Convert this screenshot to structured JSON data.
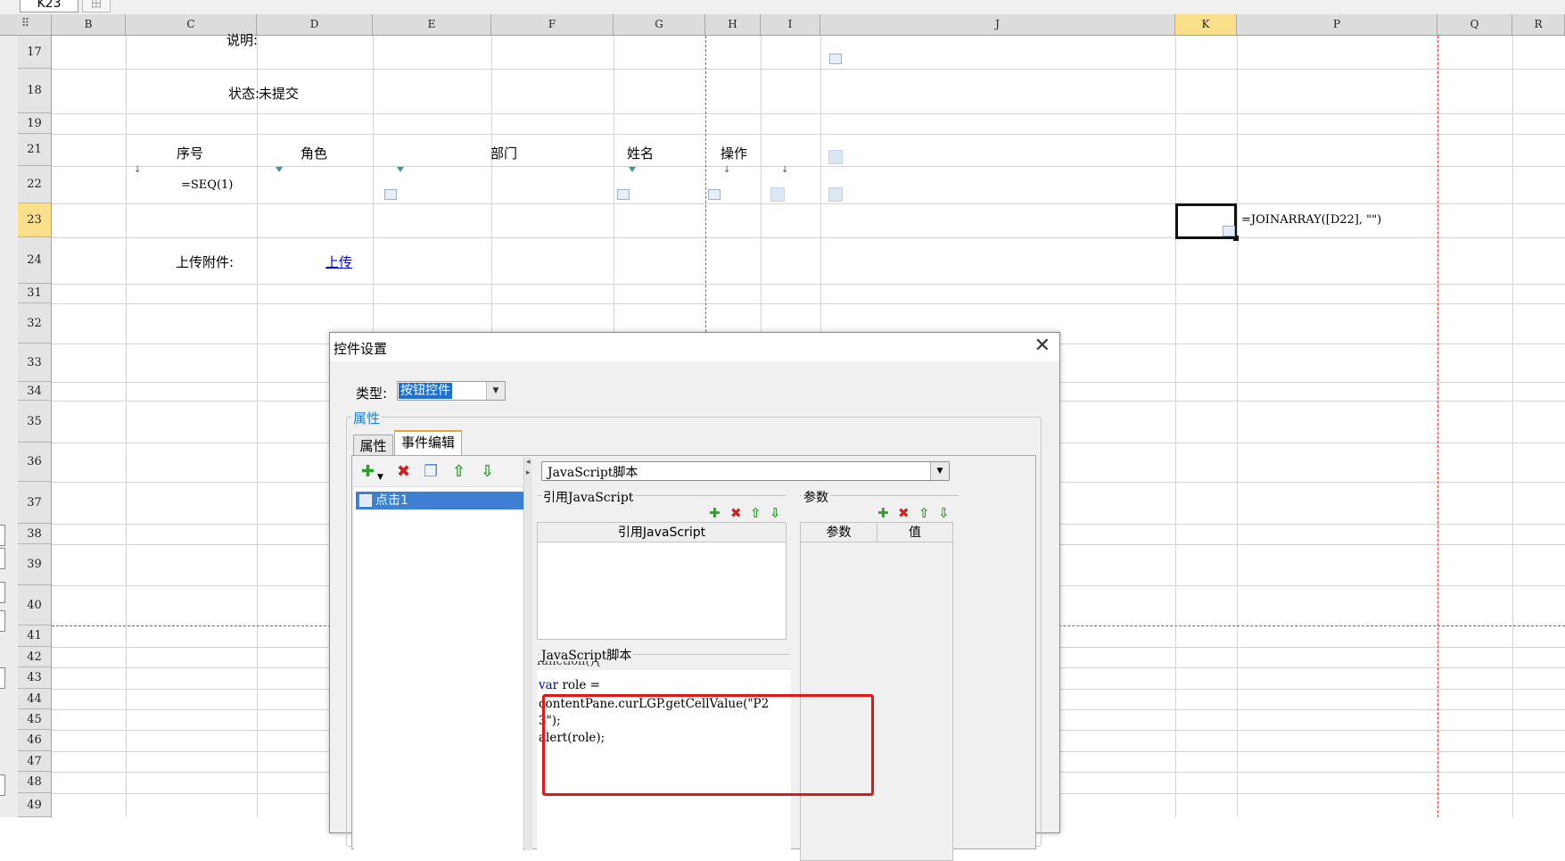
{
  "name_box": "K23",
  "fx_button": "田",
  "corner": "⠿",
  "columns": [
    "B",
    "C",
    "D",
    "E",
    "F",
    "G",
    "H",
    "I",
    "J",
    "K",
    "P",
    "Q",
    "R"
  ],
  "selected_column": "K",
  "rows": [
    "17",
    "18",
    "19",
    "21",
    "22",
    "23",
    "24",
    "31",
    "32",
    "33",
    "34",
    "35",
    "36",
    "37",
    "38",
    "39",
    "40",
    "41",
    "42",
    "43",
    "44",
    "45",
    "46",
    "47",
    "48",
    "49"
  ],
  "selected_row": "23",
  "cells": {
    "note_label": "说明:",
    "status_label": "状态:",
    "status_value": "未提交",
    "hdr_seq": "序号",
    "hdr_role": "角色",
    "hdr_dept": "部门",
    "hdr_name": "姓名",
    "hdr_action": "操作",
    "seq_formula": "=SEQ(1)",
    "joinarray_formula": "=JOINARRAY([D22], \"\")",
    "upload_label": "上传附件:",
    "upload_link": "上传"
  },
  "dialog": {
    "title": "控件设置",
    "close_glyph": "✕",
    "type_label": "类型:",
    "type_value": "按钮控件",
    "group_label": "属性",
    "tabs": [
      "属性",
      "事件编辑"
    ],
    "active_tab": "事件编辑",
    "event_items": [
      "点击1"
    ],
    "script_type": "JavaScript脚本",
    "ref_js_group": "引用JavaScript",
    "ref_js_header": "引用JavaScript",
    "params_group": "参数",
    "params_headers": [
      "参数",
      "值"
    ],
    "script_group": "JavaScript脚本",
    "script_lines": [
      "function(){",
      "var",
      "role =",
      "contentPane.curLGP.getCellValue(\"P2",
      "3\");",
      "alert(role);"
    ]
  },
  "colors": {
    "selected_header": "#fcdf8b",
    "selection_blue": "#3d7fd1",
    "accent_blue": "#1a7fd4",
    "annotation_red": "#e01818",
    "page_break_red": "#e33333",
    "keyword_blue": "#0000d0"
  },
  "icons": [
    "add-icon",
    "delete-icon",
    "copy-icon",
    "move-up-icon",
    "move-down-icon",
    "dropdown-arrow-icon",
    "close-icon",
    "event-icon"
  ]
}
